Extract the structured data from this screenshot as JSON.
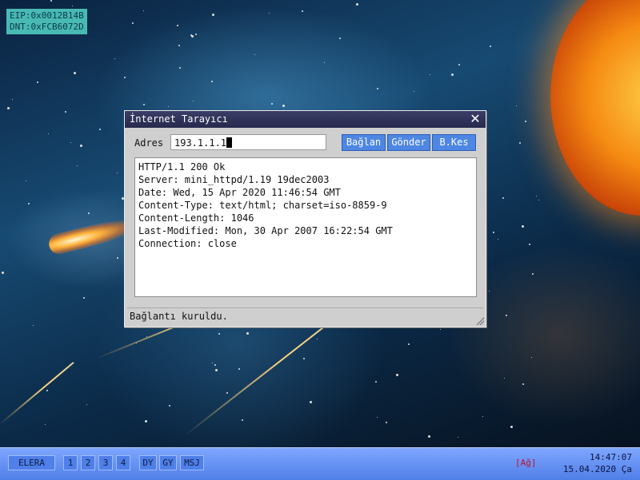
{
  "debug": {
    "eip": "EIP:0x0012B14B",
    "dnt": "DNT:0xFCB6072D"
  },
  "window": {
    "title": "İnternet Tarayıcı",
    "close_icon": "close-icon",
    "address_label": "Adres",
    "address_value": "193.1.1.1",
    "buttons": {
      "connect": "Bağlan",
      "send": "Gönder",
      "disconnect": "B.Kes"
    },
    "response_lines": [
      "HTTP/1.1 200 Ok",
      "Server: mini_httpd/1.19 19dec2003",
      "Date: Wed, 15 Apr 2020 11:46:54 GMT",
      "Content-Type: text/html; charset=iso-8859-9",
      "Content-Length: 1046",
      "Last-Modified: Mon, 30 Apr 2007 16:22:54 GMT",
      "Connection: close"
    ],
    "status": "Bağlantı kuruldu."
  },
  "taskbar": {
    "start": "ELERA",
    "workspaces": [
      "1",
      "2",
      "3",
      "4"
    ],
    "dy": "DY",
    "gy": "GY",
    "msj": "MSJ",
    "network": "[Ağ]",
    "time": "14:47:07",
    "date": "15.04.2020 Ça"
  },
  "colors": {
    "taskbar": "#4f7fe8",
    "titlebar": "#272a4d",
    "button": "#4d86e3",
    "network_status": "#c4102a"
  }
}
